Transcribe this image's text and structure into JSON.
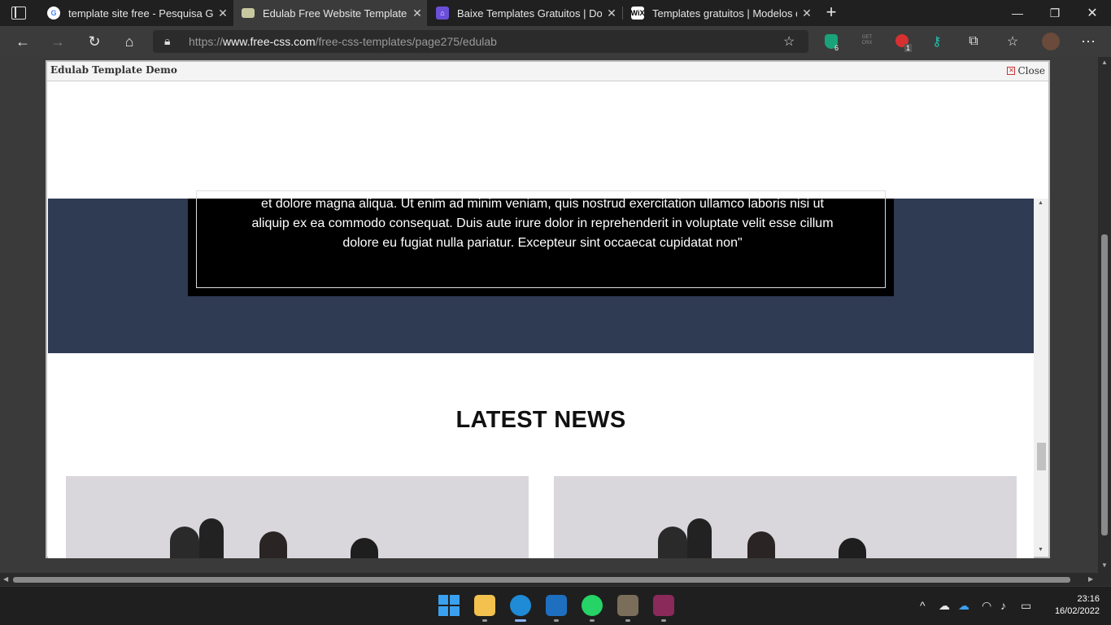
{
  "browser": {
    "tabs": [
      {
        "title": "template site free - Pesquisa Goo",
        "favicon": "google-icon",
        "active": false
      },
      {
        "title": "Edulab Free Website Template | F",
        "favicon": "free-css-icon",
        "active": true
      },
      {
        "title": "Baixe Templates Gratuitos | Down",
        "favicon": "templates-icon",
        "active": false
      },
      {
        "title": "Templates gratuitos | Modelos de",
        "favicon": "wix-icon",
        "active": false
      }
    ],
    "new_tab_icon": "plus-icon",
    "url_prefix": "https://",
    "url_domain": "www.free-css.com",
    "url_path": "/free-css-templates/page275/edulab",
    "extension_badges": {
      "ext1": "6",
      "ext3": "1"
    },
    "ext_getcrx_label": "GET CRX"
  },
  "demo": {
    "title": "Edulab Template Demo",
    "close_label": "Close",
    "quote_text": "et dolore magna aliqua. Ut enim ad minim veniam, quis nostrud exercitation ullamco laboris nisi ut aliquip ex ea commodo consequat. Duis aute irure dolor in reprehenderit in voluptate velit esse cillum dolore eu fugiat nulla pariatur. Excepteur sint occaecat cupidatat non\"",
    "news_heading": "LATEST NEWS"
  },
  "colors": {
    "testimonial_bg": "#2f3a53",
    "chrome_dark": "#202020",
    "chrome_toolbar": "#3b3b3b"
  },
  "taskbar": {
    "time": "23:16",
    "date": "16/02/2022"
  }
}
